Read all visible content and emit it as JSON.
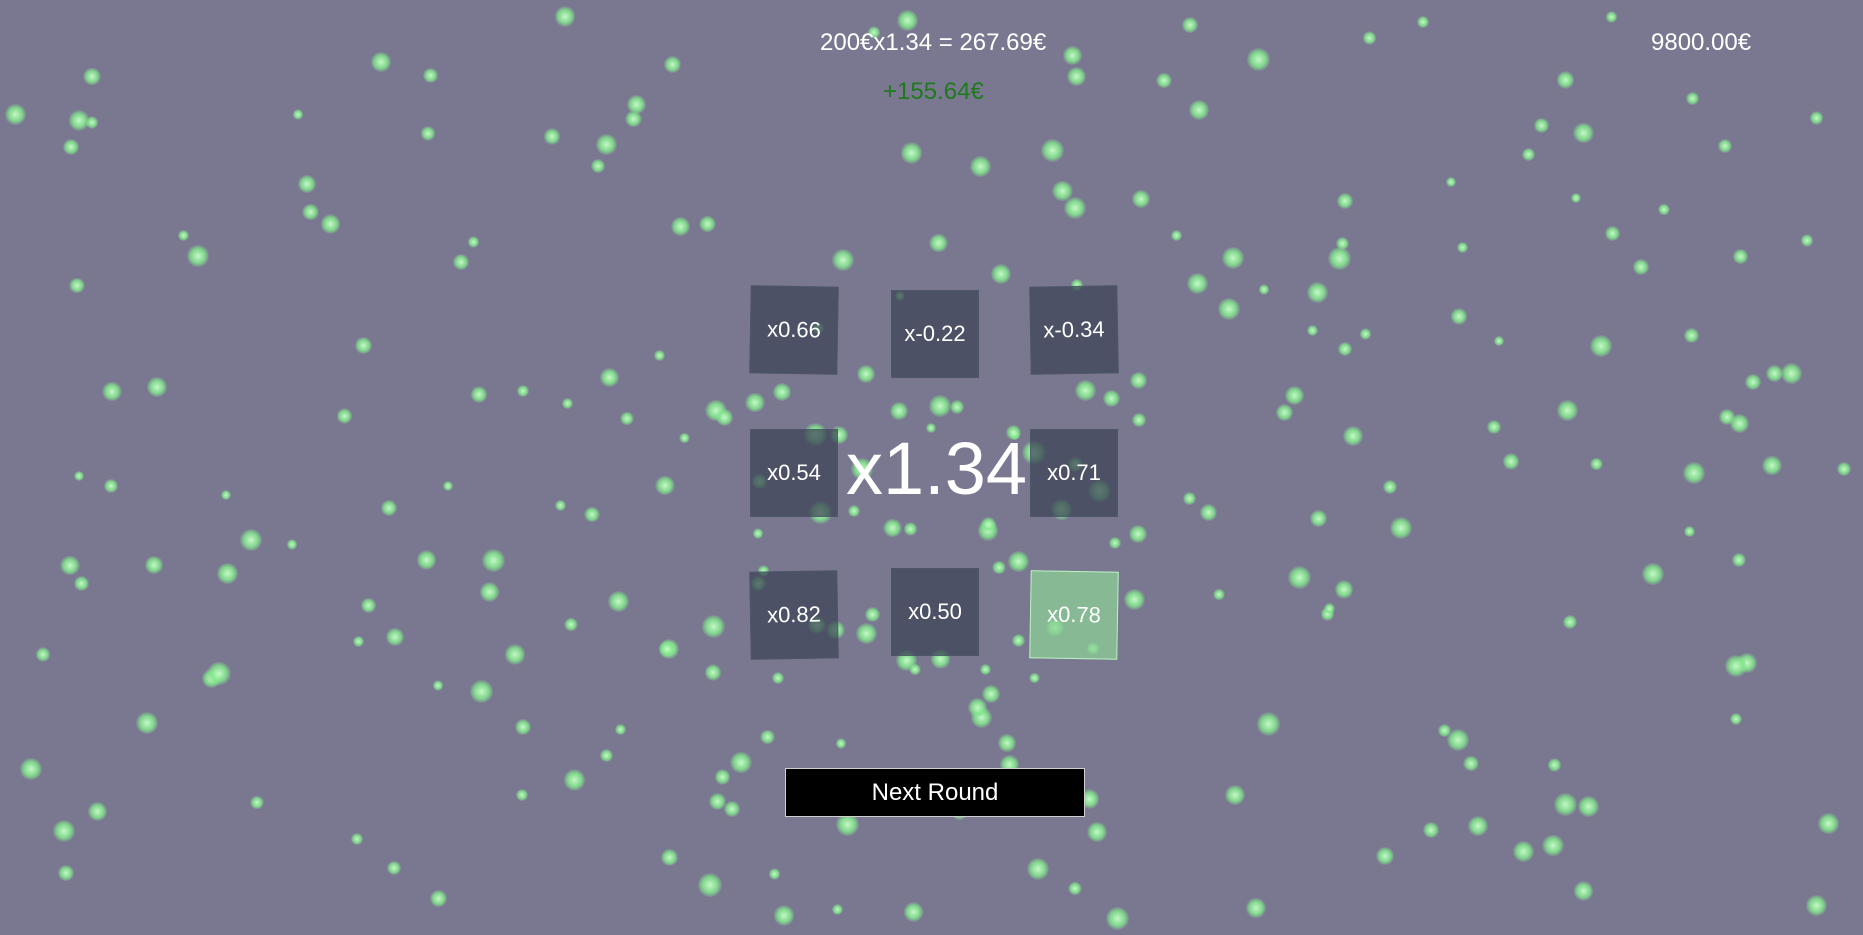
{
  "hud": {
    "bet_formula": "200€x1.34 = 267.69€",
    "win_amount": "+155.64€",
    "balance": "9800.00€"
  },
  "grid": {
    "tiles": [
      {
        "label": "x0.66",
        "selected": false
      },
      {
        "label": "x-0.22",
        "selected": false
      },
      {
        "label": "x-0.34",
        "selected": false
      },
      {
        "label": "x0.54",
        "selected": false
      },
      {
        "label": "x0.71",
        "selected": false
      },
      {
        "label": "x0.82",
        "selected": false
      },
      {
        "label": "x0.50",
        "selected": false
      },
      {
        "label": "x0.78",
        "selected": true
      }
    ],
    "center_multiplier": "x1.34"
  },
  "actions": {
    "next_round_label": "Next Round"
  },
  "colors": {
    "background": "#7a7891",
    "win_text": "#1d7a1d",
    "particle": "#8fe39a",
    "selected_tile": "#8cd296"
  }
}
